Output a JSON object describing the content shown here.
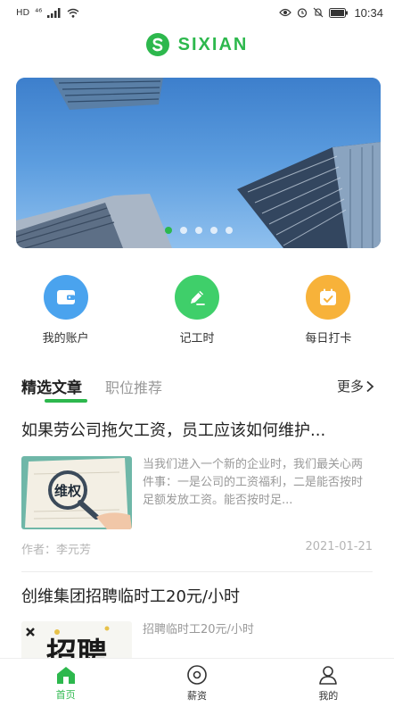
{
  "status_bar": {
    "network_left": "HD",
    "signal_text": "⁴⁶",
    "time": "10:34"
  },
  "header": {
    "logo_text": "SIXIAN",
    "brand_color": "#2db84d"
  },
  "banner": {
    "slide_count": 5,
    "active_index": 0
  },
  "quick_actions": [
    {
      "label": "我的账户",
      "icon": "wallet-icon",
      "color": "#4aa3ee"
    },
    {
      "label": "记工时",
      "icon": "edit-icon",
      "color": "#3fcf6a"
    },
    {
      "label": "每日打卡",
      "icon": "calendar-check-icon",
      "color": "#f7b23a"
    }
  ],
  "tabs": {
    "items": [
      {
        "label": "精选文章",
        "active": true
      },
      {
        "label": "职位推荐",
        "active": false
      }
    ],
    "more_label": "更多"
  },
  "articles": [
    {
      "title": "如果劳公司拖欠工资，员工应该如何维护...",
      "thumb_text": "维权",
      "summary": "当我们进入一个新的企业时，我们最关心两件事：一是公司的工资福利，二是能否按时足额发放工资。能否按时足...",
      "author": "作者：李元芳",
      "date": "2021-01-21"
    },
    {
      "title": "创维集团招聘临时工20元/小时",
      "thumb_text": "招聘",
      "summary": "招聘临时工20元/小时"
    }
  ],
  "bottom_nav": [
    {
      "label": "首页",
      "icon": "home-icon",
      "active": true
    },
    {
      "label": "薪资",
      "icon": "salary-icon",
      "active": false
    },
    {
      "label": "我的",
      "icon": "profile-icon",
      "active": false
    }
  ]
}
